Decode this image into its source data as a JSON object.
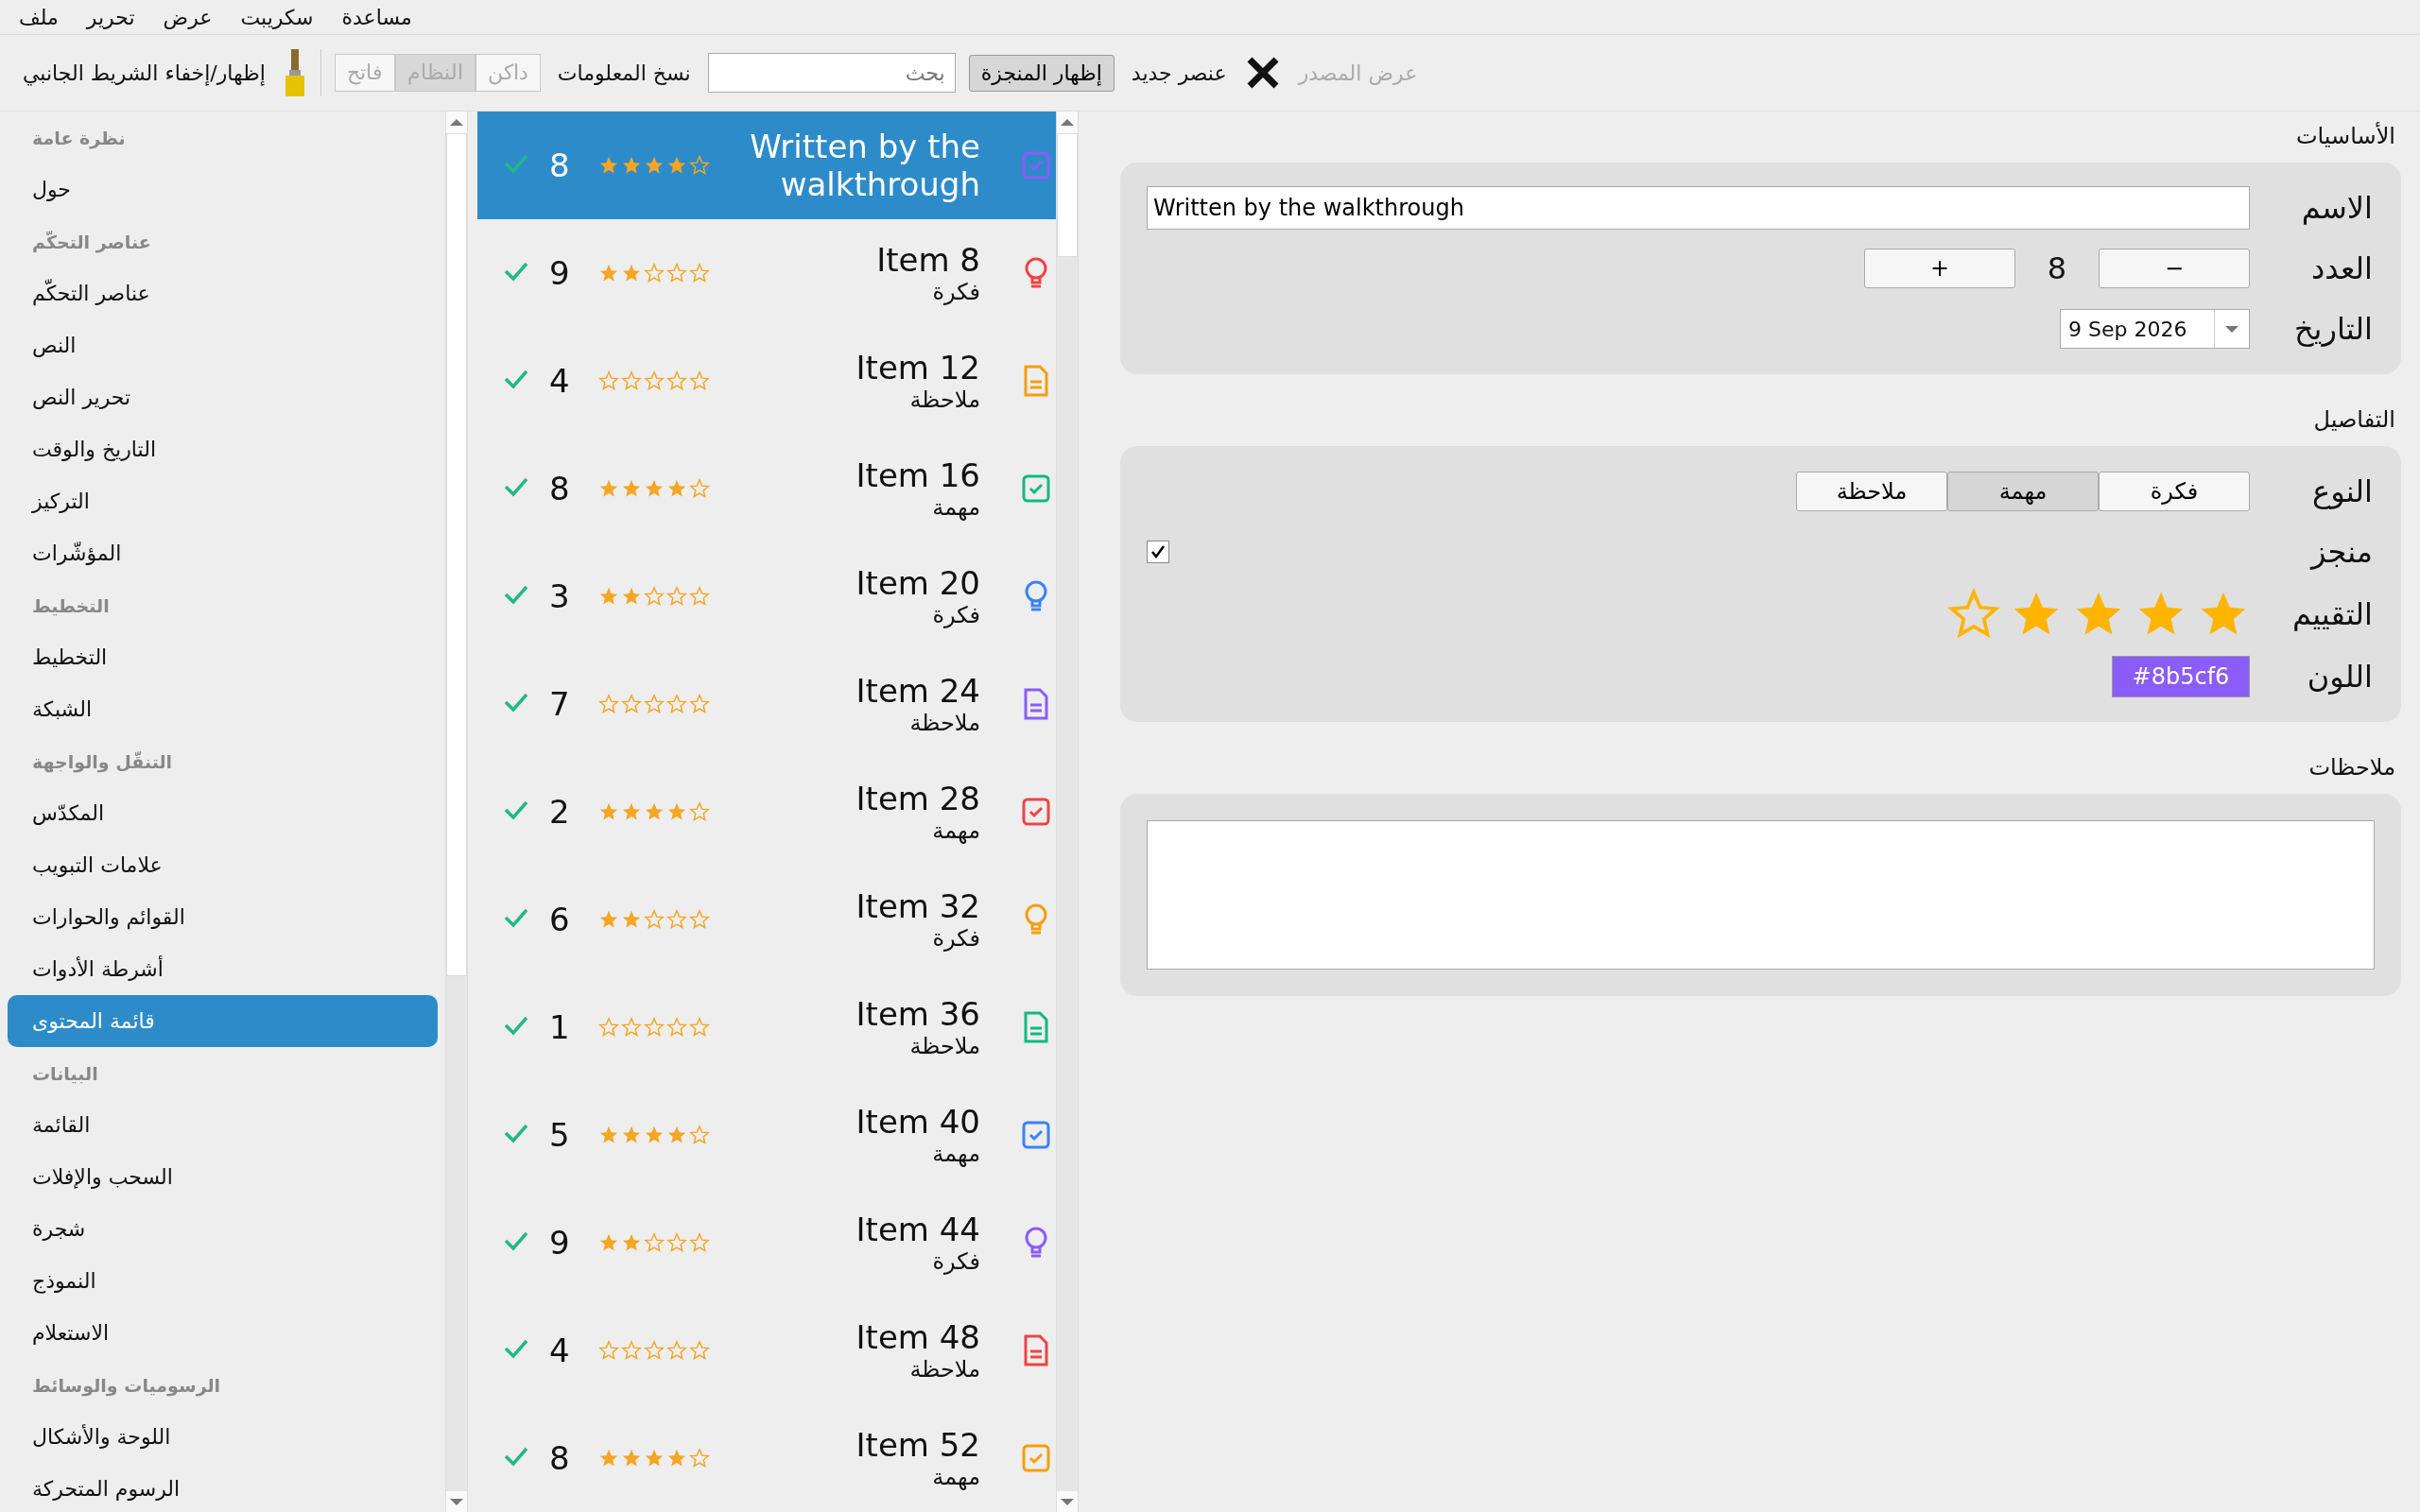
{
  "menu": [
    "مساعدة",
    "سكريبت",
    "عرض",
    "تحرير",
    "ملف"
  ],
  "toolbar": {
    "sidebar_toggle": "إظهار/إخفاء الشريط الجانبي",
    "theme_options": [
      {
        "label": "داكن",
        "selected": false,
        "disabled": true
      },
      {
        "label": "النظام",
        "selected": true,
        "disabled": true
      },
      {
        "label": "فاتح",
        "selected": false,
        "disabled": true
      }
    ],
    "copy_info": "نسخ المعلومات",
    "search": {
      "placeholder": "بحث"
    },
    "show_done": {
      "label": "إظهار المنجزة",
      "checked": true
    },
    "new_item": "عنصر جديد",
    "view_source": {
      "label": "عرض المصدر",
      "disabled": true
    }
  },
  "sidebar": [
    {
      "header": "نظرة عامة",
      "items": [
        {
          "label": "حول",
          "selected": false
        }
      ]
    },
    {
      "header": "عناصر التحكّم",
      "items": [
        {
          "label": "عناصر التحكّم",
          "selected": false
        },
        {
          "label": "النص",
          "selected": false
        },
        {
          "label": "تحرير النص",
          "selected": false
        },
        {
          "label": "التاريخ والوقت",
          "selected": false
        },
        {
          "label": "التركيز",
          "selected": false
        },
        {
          "label": "المؤشّرات",
          "selected": false
        }
      ]
    },
    {
      "header": "التخطيط",
      "items": [
        {
          "label": "التخطيط",
          "selected": false
        },
        {
          "label": "الشبكة",
          "selected": false
        }
      ]
    },
    {
      "header": "التنقّل والواجهة",
      "items": [
        {
          "label": "المكدّس",
          "selected": false
        },
        {
          "label": "علامات التبويب",
          "selected": false
        },
        {
          "label": "القوائم والحوارات",
          "selected": false
        },
        {
          "label": "أشرطة الأدوات",
          "selected": false
        },
        {
          "label": "قائمة المحتوى",
          "selected": true
        }
      ]
    },
    {
      "header": "البيانات",
      "items": [
        {
          "label": "القائمة",
          "selected": false
        },
        {
          "label": "السحب والإفلات",
          "selected": false
        },
        {
          "label": "شجرة",
          "selected": false
        },
        {
          "label": "النموذج",
          "selected": false
        },
        {
          "label": "الاستعلام",
          "selected": false
        }
      ]
    },
    {
      "header": "الرسوميات والوسائط",
      "items": [
        {
          "label": "اللوحة والأشكال",
          "selected": false
        },
        {
          "label": "الرسوم المتحركة",
          "selected": false
        }
      ]
    }
  ],
  "items": [
    {
      "title": "Written by the walkthrough",
      "kind": "task",
      "color": "#8b5cf6",
      "count": "8",
      "stars": 4,
      "done": true,
      "selected": true
    },
    {
      "title": "Item 8",
      "type_label": "فكرة",
      "kind": "idea",
      "color": "#ef4444",
      "count": "9",
      "stars": 2,
      "done": true,
      "selected": false
    },
    {
      "title": "Item 12",
      "type_label": "ملاحظة",
      "kind": "note",
      "color": "#f59e0b",
      "count": "4",
      "stars": 0,
      "done": true,
      "selected": false
    },
    {
      "title": "Item 16",
      "type_label": "مهمة",
      "kind": "task",
      "color": "#10b981",
      "count": "8",
      "stars": 4,
      "done": true,
      "selected": false
    },
    {
      "title": "Item 20",
      "type_label": "فكرة",
      "kind": "idea",
      "color": "#3b82f6",
      "count": "3",
      "stars": 2,
      "done": true,
      "selected": false
    },
    {
      "title": "Item 24",
      "type_label": "ملاحظة",
      "kind": "note",
      "color": "#8b5cf6",
      "count": "7",
      "stars": 0,
      "done": true,
      "selected": false
    },
    {
      "title": "Item 28",
      "type_label": "مهمة",
      "kind": "task",
      "color": "#ef4444",
      "count": "2",
      "stars": 4,
      "done": true,
      "selected": false
    },
    {
      "title": "Item 32",
      "type_label": "فكرة",
      "kind": "idea",
      "color": "#f59e0b",
      "count": "6",
      "stars": 2,
      "done": true,
      "selected": false
    },
    {
      "title": "Item 36",
      "type_label": "ملاحظة",
      "kind": "note",
      "color": "#10b981",
      "count": "1",
      "stars": 0,
      "done": true,
      "selected": false
    },
    {
      "title": "Item 40",
      "type_label": "مهمة",
      "kind": "task",
      "color": "#3b82f6",
      "count": "5",
      "stars": 4,
      "done": true,
      "selected": false
    },
    {
      "title": "Item 44",
      "type_label": "فكرة",
      "kind": "idea",
      "color": "#8b5cf6",
      "count": "9",
      "stars": 2,
      "done": true,
      "selected": false
    },
    {
      "title": "Item 48",
      "type_label": "ملاحظة",
      "kind": "note",
      "color": "#ef4444",
      "count": "4",
      "stars": 0,
      "done": true,
      "selected": false
    },
    {
      "title": "Item 52",
      "type_label": "مهمة",
      "kind": "task",
      "color": "#f59e0b",
      "count": "8",
      "stars": 4,
      "done": true,
      "selected": false
    }
  ],
  "details": {
    "basics": {
      "title": "الأساسيات",
      "name_label": "الاسم",
      "name_value": "Written by the walkthrough",
      "count_label": "العدد",
      "decrement": "−",
      "count": "8",
      "increment": "+",
      "date_label": "التاريخ",
      "date": "9 Sep 2026"
    },
    "info": {
      "title": "التفاصيل",
      "type_label": "النوع",
      "types": [
        {
          "label": "فكرة",
          "selected": false
        },
        {
          "label": "مهمة",
          "selected": true
        },
        {
          "label": "ملاحظة",
          "selected": false
        }
      ],
      "done_label": "منجز",
      "done": true,
      "rating_label": "التقييم",
      "stars": 4,
      "color_label": "اللون",
      "color": "#8b5cf6",
      "color_text": "#8b5cf6"
    },
    "notes": {
      "title": "ملاحظات"
    }
  }
}
